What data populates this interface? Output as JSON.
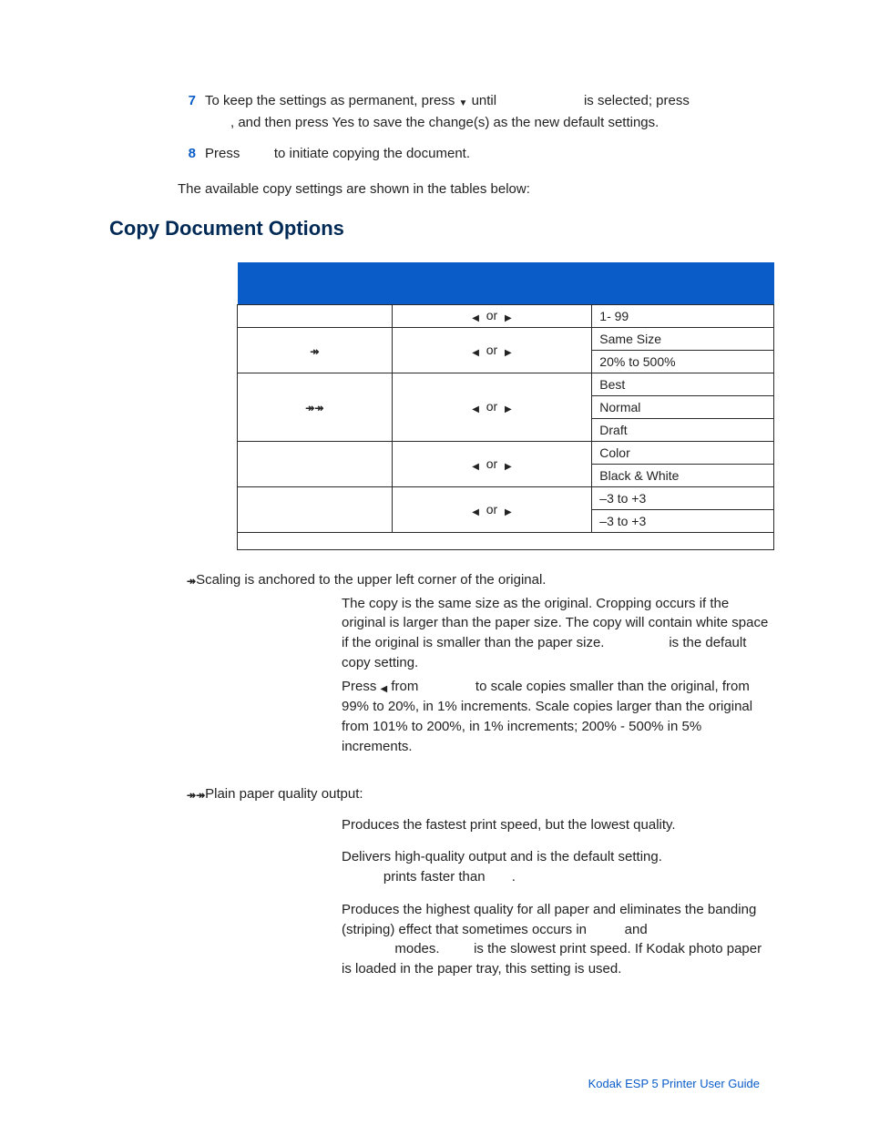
{
  "steps": {
    "s7": {
      "num": "7",
      "pre": "To keep the settings as permanent, press ",
      "mid": " until ",
      "blank1": "                     ",
      "post1": " is selected; press",
      "line2": ", and then press Yes to save the change(s) as the new default settings."
    },
    "s8": {
      "num": "8",
      "pre": "Press ",
      "post": " to initiate copying the document."
    }
  },
  "available": "The available copy settings are shown in the tables below:",
  "section_title": "Copy Document Options",
  "or_word": "or",
  "table": {
    "rows": [
      {
        "opt": "",
        "nav": true,
        "vals": [
          "1- 99"
        ]
      },
      {
        "opt": "asterisk1",
        "nav": true,
        "vals": [
          "Same Size",
          "20% to 500%"
        ]
      },
      {
        "opt": "asterisk2",
        "nav": true,
        "vals": [
          "Best",
          "Normal",
          "Draft"
        ]
      },
      {
        "opt": "",
        "nav": true,
        "vals": [
          "Color",
          "Black & White"
        ]
      },
      {
        "opt": "",
        "nav": true,
        "vals": [
          "–3 to +3",
          "–3 to +3"
        ]
      }
    ]
  },
  "fn1": "Scaling is anchored to the upper left corner of the original.",
  "def_same_1": "The copy is the same size as the original. Cropping occurs if the original is larger than the paper size. The copy will contain white space if the original is smaller than the paper size. ",
  "def_same_blank": "               ",
  "def_same_2": " is the default copy setting.",
  "def_scale_pre": "Press ",
  "def_scale_mid": " from ",
  "def_scale_blank": "             ",
  "def_scale_post": " to scale copies smaller than the original, from 99% to 20%, in 1% increments. Scale copies larger than the original from 101% to 200%, in 1% increments; 200% - 500% in 5% increments.",
  "quality_intro": "Plain paper quality output:",
  "q_draft": "Produces the fastest print speed, but the lowest quality.",
  "q_norm1": "Delivers high-quality output and is the default setting. ",
  "q_norm2": " prints faster than ",
  "q_norm3": ".",
  "q_best1": "Produces the highest quality for all paper and eliminates the banding (striping) effect that sometimes occurs in ",
  "q_best2": " and ",
  "q_best3": " modes. ",
  "q_best4": " is the slowest print speed. If Kodak photo paper is loaded in the paper tray, this setting is used.",
  "footer": "Kodak ESP 5 Printer User Guide"
}
